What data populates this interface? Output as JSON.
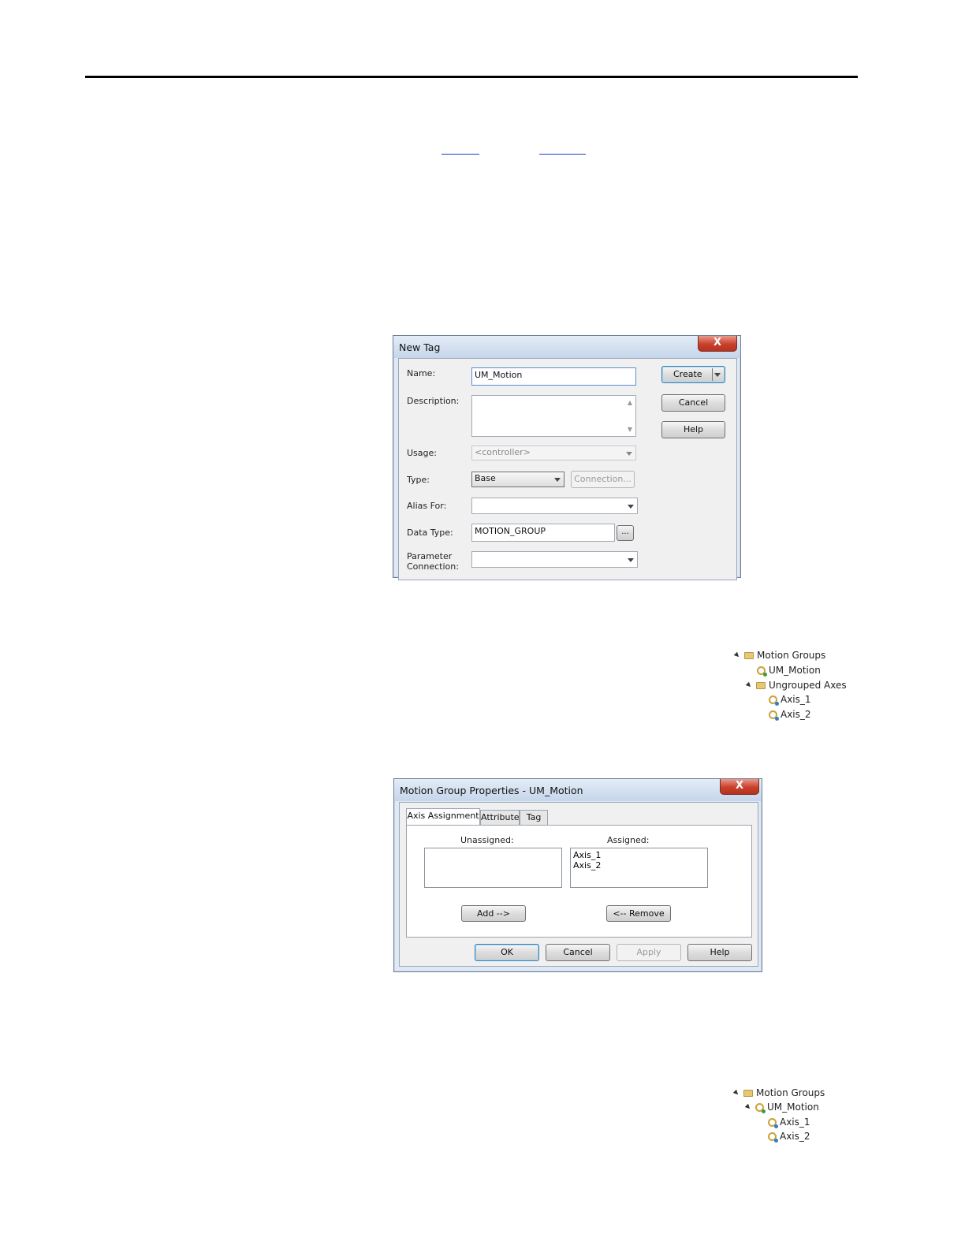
{
  "new_tag_dialog": {
    "title": "New Tag",
    "close_glyph": "X",
    "name_label": "Name:",
    "name_value": "UM_Motion",
    "description_label": "Description:",
    "usage_label": "Usage:",
    "usage_value": "<controller>",
    "type_label": "Type:",
    "type_value": "Base",
    "connection_button": "Connection...",
    "alias_label": "Alias For:",
    "data_type_label": "Data Type:",
    "data_type_value": "MOTION_GROUP",
    "browse_button": "...",
    "param_label_1": "Parameter",
    "param_label_2": "Connection:",
    "create_button": "Create",
    "cancel_button": "Cancel",
    "help_button": "Help"
  },
  "tree_before": {
    "items": [
      "Motion Groups",
      "UM_Motion",
      "Ungrouped Axes",
      "Axis_1",
      "Axis_2"
    ]
  },
  "motion_group_dialog": {
    "title": "Motion Group Properties - UM_Motion",
    "close_glyph": "X",
    "tabs": [
      "Axis Assignment",
      "Attribute",
      "Tag"
    ],
    "unassigned_label": "Unassigned:",
    "assigned_label": "Assigned:",
    "assigned_items": [
      "Axis_1",
      "Axis_2"
    ],
    "add_button": "Add -->",
    "remove_button": "<-- Remove",
    "ok_button": "OK",
    "cancel_button": "Cancel",
    "apply_button": "Apply",
    "help_button": "Help"
  },
  "tree_after": {
    "items": [
      "Motion Groups",
      "UM_Motion",
      "Axis_1",
      "Axis_2"
    ]
  }
}
